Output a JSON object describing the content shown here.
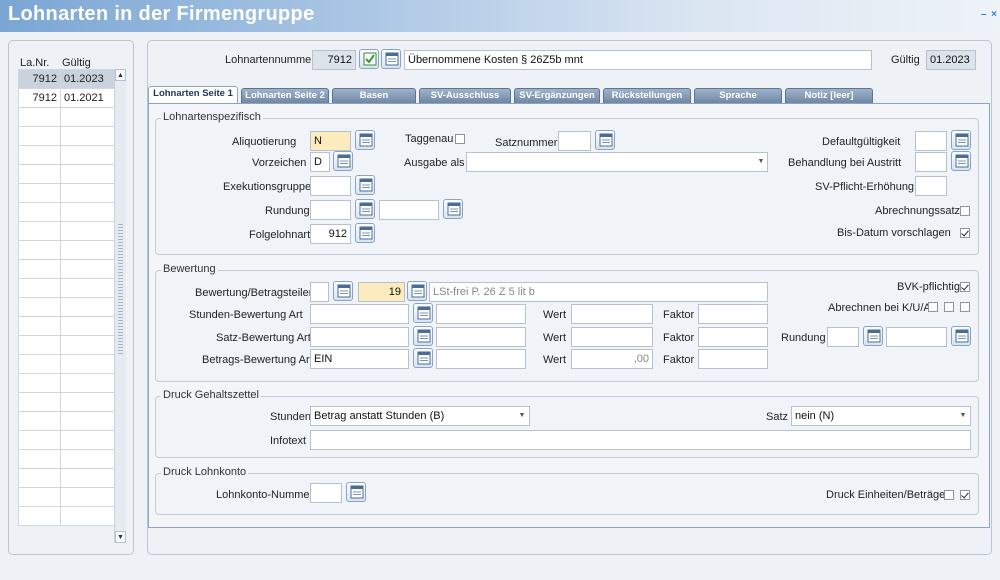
{
  "window": {
    "title": "Lohnarten in der Firmengruppe",
    "min_label": "–",
    "close_label": "×"
  },
  "list": {
    "headers": [
      "La.Nr.",
      "Gültig"
    ],
    "rows": [
      {
        "nr": "7912",
        "gueltig": "01.2023"
      },
      {
        "nr": "7912",
        "gueltig": "01.2021"
      }
    ]
  },
  "header": {
    "lohnart_label": "Lohnartennummer",
    "lohnart_value": "7912",
    "beschreibung": "Übernommene Kosten § 26Z5b mnt",
    "gueltig_label": "Gültig",
    "gueltig_value": "01.2023"
  },
  "tabs": [
    "Lohnarten Seite 1",
    "Lohnarten Seite 2",
    "Basen",
    "SV-Ausschluss",
    "SV-Ergänzungen",
    "Rückstellungen",
    "Sprache",
    "Notiz [leer]"
  ],
  "spez": {
    "title": "Lohnartenspezifisch",
    "aliquotierung_label": "Aliquotierung",
    "aliquotierung_value": "N",
    "taggenau_label": "Taggenau",
    "satznummer_label": "Satznummer",
    "defaultgueltigkeit_label": "Defaultgültigkeit",
    "vorzeichen_label": "Vorzeichen",
    "vorzeichen_value": "D",
    "ausgabe_label": "Ausgabe als",
    "behandlung_label": "Behandlung bei Austritt",
    "exekution_label": "Exekutionsgruppe",
    "svpflicht_label": "SV-Pflicht-Erhöhung",
    "rundung_label": "Rundung",
    "abrechnungssatz_label": "Abrechnungssatz",
    "folgelohnart_label": "Folgelohnart",
    "folgelohnart_value": "912",
    "bisdatum_label": "Bis-Datum vorschlagen"
  },
  "bewertung": {
    "title": "Bewertung",
    "betragsteiler_label": "Bewertung/Betragsteiler",
    "betragsteiler_value": "19",
    "betragsteiler_text": "LSt-frei P. 26 Z 5 lit b",
    "bvk_label": "BVK-pflichtig",
    "stunden_label": "Stunden-Bewertung Art",
    "wert_label": "Wert",
    "faktor_label": "Faktor",
    "abrechnen_label": "Abrechnen bei K/U/A",
    "satz_label": "Satz-Bewertung Art",
    "rundung_label": "Rundung",
    "betrags_label": "Betrags-Bewertung Art",
    "betrags_value": "EIN",
    "betrags_wert": ",00"
  },
  "druck_gehalt": {
    "title": "Druck Gehaltszettel",
    "stunden_label": "Stunden",
    "stunden_value": "Betrag anstatt Stunden (B)",
    "satz_label": "Satz",
    "satz_value": "nein (N)",
    "infotext_label": "Infotext"
  },
  "druck_konto": {
    "title": "Druck Lohnkonto",
    "nummer_label": "Lohnkonto-Nummer",
    "einheiten_label": "Druck Einheiten/Beträge"
  }
}
